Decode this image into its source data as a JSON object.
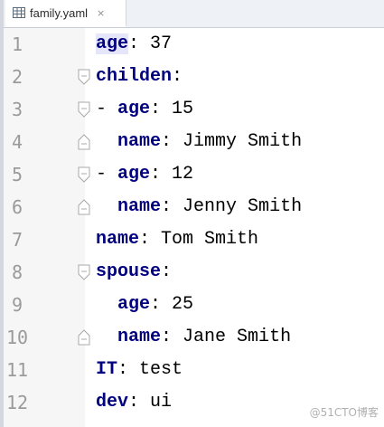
{
  "tab": {
    "icon": "table-icon",
    "filename": "family.yaml",
    "close": "×"
  },
  "editor": {
    "lines": [
      {
        "num": "1",
        "indent": "",
        "dash": "",
        "key": "age",
        "sep": ": ",
        "value": "37"
      },
      {
        "num": "2",
        "indent": "",
        "dash": "",
        "key": "childen",
        "sep": ":",
        "value": ""
      },
      {
        "num": "3",
        "indent": "",
        "dash": "- ",
        "key": "age",
        "sep": ": ",
        "value": "15"
      },
      {
        "num": "4",
        "indent": "  ",
        "dash": "",
        "key": "name",
        "sep": ": ",
        "value": "Jimmy Smith"
      },
      {
        "num": "5",
        "indent": "",
        "dash": "- ",
        "key": "age",
        "sep": ": ",
        "value": "12"
      },
      {
        "num": "6",
        "indent": "  ",
        "dash": "",
        "key": "name",
        "sep": ": ",
        "value": "Jenny Smith"
      },
      {
        "num": "7",
        "indent": "",
        "dash": "",
        "key": "name",
        "sep": ": ",
        "value": "Tom Smith"
      },
      {
        "num": "8",
        "indent": "",
        "dash": "",
        "key": "spouse",
        "sep": ":",
        "value": ""
      },
      {
        "num": "9",
        "indent": "  ",
        "dash": "",
        "key": "age",
        "sep": ": ",
        "value": "25"
      },
      {
        "num": "10",
        "indent": "  ",
        "dash": "",
        "key": "name",
        "sep": ": ",
        "value": "Jane Smith"
      },
      {
        "num": "11",
        "indent": "",
        "dash": "",
        "key": "IT",
        "sep": ": ",
        "value": "test"
      },
      {
        "num": "12",
        "indent": "",
        "dash": "",
        "key": "dev",
        "sep": ": ",
        "value": "ui"
      }
    ]
  },
  "watermark": "@51CTO博客",
  "colors": {
    "key": "#000080",
    "current_line_key_bg": "#e6e6fa",
    "gutter_bg": "#f6f6f6",
    "line_number": "#9a9a9a"
  }
}
